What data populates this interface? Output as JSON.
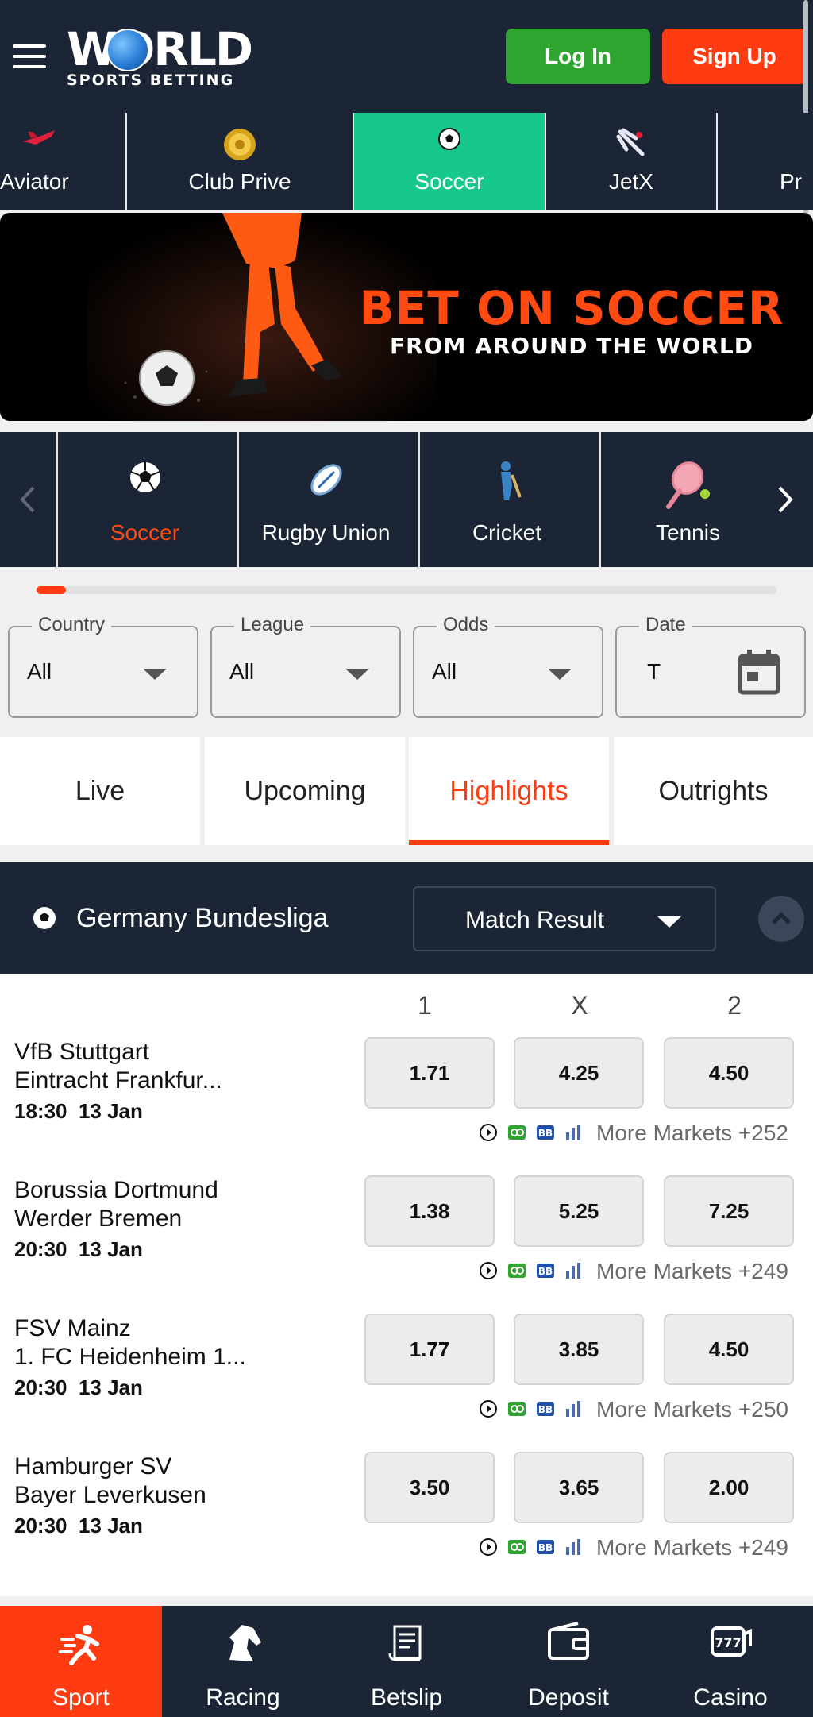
{
  "header": {
    "logo_main": "WORLD",
    "logo_sub": "SPORTS BETTING",
    "login_label": "Log In",
    "signup_label": "Sign Up"
  },
  "game_tabs": [
    {
      "label": "Aviator",
      "icon": "plane-icon"
    },
    {
      "label": "Club Prive",
      "icon": "gold-coin-icon"
    },
    {
      "label": "Soccer",
      "icon": "soccer-ball-icon",
      "active": true
    },
    {
      "label": "JetX",
      "icon": "jet-icon"
    },
    {
      "label": "Pr",
      "icon": "promo-icon"
    }
  ],
  "banner": {
    "title": "BET ON SOCCER",
    "subtitle": "FROM AROUND THE WORLD"
  },
  "sports": [
    {
      "label": "Soccer",
      "icon": "soccer-ball-icon",
      "active": true
    },
    {
      "label": "Rugby Union",
      "icon": "rugby-ball-icon"
    },
    {
      "label": "Cricket",
      "icon": "cricket-player-icon"
    },
    {
      "label": "Tennis",
      "icon": "tennis-racket-icon"
    }
  ],
  "sports_scroll_progress": 0.04,
  "filters": {
    "country": {
      "label": "Country",
      "value": "All"
    },
    "league": {
      "label": "League",
      "value": "All"
    },
    "odds": {
      "label": "Odds",
      "value": "All"
    },
    "date": {
      "label": "Date",
      "value": "T"
    }
  },
  "subtabs": [
    {
      "label": "Live"
    },
    {
      "label": "Upcoming"
    },
    {
      "label": "Highlights",
      "active": true
    },
    {
      "label": "Outrights"
    }
  ],
  "league": {
    "name": "Germany Bundesliga",
    "market": "Match Result"
  },
  "columns": [
    "1",
    "X",
    "2"
  ],
  "matches": [
    {
      "home": "VfB Stuttgart",
      "away": "Eintracht Frankfur...",
      "time": "18:30",
      "date": "13 Jan",
      "odds": [
        "1.71",
        "4.25",
        "4.50"
      ],
      "more": "More Markets +252"
    },
    {
      "home": "Borussia Dortmund",
      "away": "Werder Bremen",
      "time": "20:30",
      "date": "13 Jan",
      "odds": [
        "1.38",
        "5.25",
        "7.25"
      ],
      "more": "More Markets +249"
    },
    {
      "home": "FSV Mainz",
      "away": "1. FC Heidenheim 1...",
      "time": "20:30",
      "date": "13 Jan",
      "odds": [
        "1.77",
        "3.85",
        "4.50"
      ],
      "more": "More Markets +250"
    },
    {
      "home": "Hamburger SV",
      "away": "Bayer Leverkusen",
      "time": "20:30",
      "date": "13 Jan",
      "odds": [
        "3.50",
        "3.65",
        "2.00"
      ],
      "more": "More Markets +249"
    }
  ],
  "bottom_nav": [
    {
      "label": "Sport",
      "icon": "running-icon",
      "active": true
    },
    {
      "label": "Racing",
      "icon": "horse-head-icon"
    },
    {
      "label": "Betslip",
      "icon": "receipt-icon"
    },
    {
      "label": "Deposit",
      "icon": "wallet-icon"
    },
    {
      "label": "Casino",
      "icon": "slot-777-icon"
    }
  ],
  "colors": {
    "navy": "#1b2536",
    "accent_orange": "#ff3b12",
    "login_green": "#2ea52e",
    "active_green": "#16c98b"
  }
}
